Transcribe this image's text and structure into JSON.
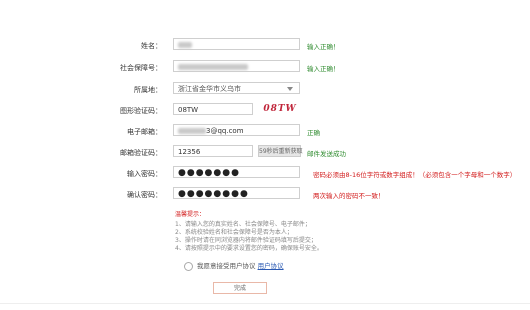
{
  "form": {
    "name": {
      "label": "姓名：",
      "value_hint": "",
      "status": "输入正确！"
    },
    "social_id": {
      "label": "社会保障号：",
      "status": "输入正确！"
    },
    "city": {
      "label": "所属地：",
      "value": "浙江省金华市义乌市"
    },
    "captcha": {
      "label": "图形验证码：",
      "value": "08TW",
      "image_text": "08TW"
    },
    "email": {
      "label": "电子邮箱：",
      "value_suffix": "3@qq.com",
      "status": "正确"
    },
    "email_code": {
      "label": "邮箱验证码：",
      "value": "12356",
      "button": "59秒后重新获取",
      "status": "邮件发送成功"
    },
    "password": {
      "label": "输入密码：",
      "value": "●●●●●●●",
      "status": "密码必须由8-16位字符或数字组成！（必须包含一个字母和一个数字）"
    },
    "confirm_password": {
      "label": "确认密码：",
      "value": "●●●●●●●●",
      "status": "两次输入的密码不一致！"
    }
  },
  "notes": {
    "title": "温馨提示：",
    "items": [
      "1、请输入您的真实姓名、社会保障号、电子邮件；",
      "2、系统校验姓名和社会保障号是否为本人；",
      "3、操作时请在同浏览器内将邮件验证码填写后提交；",
      "4、请按照提示中的要求设置您的密码，确保账号安全。"
    ]
  },
  "agree": {
    "text": "我愿意接受用户协议",
    "link": "用户协议"
  },
  "submit_label": "完成"
}
